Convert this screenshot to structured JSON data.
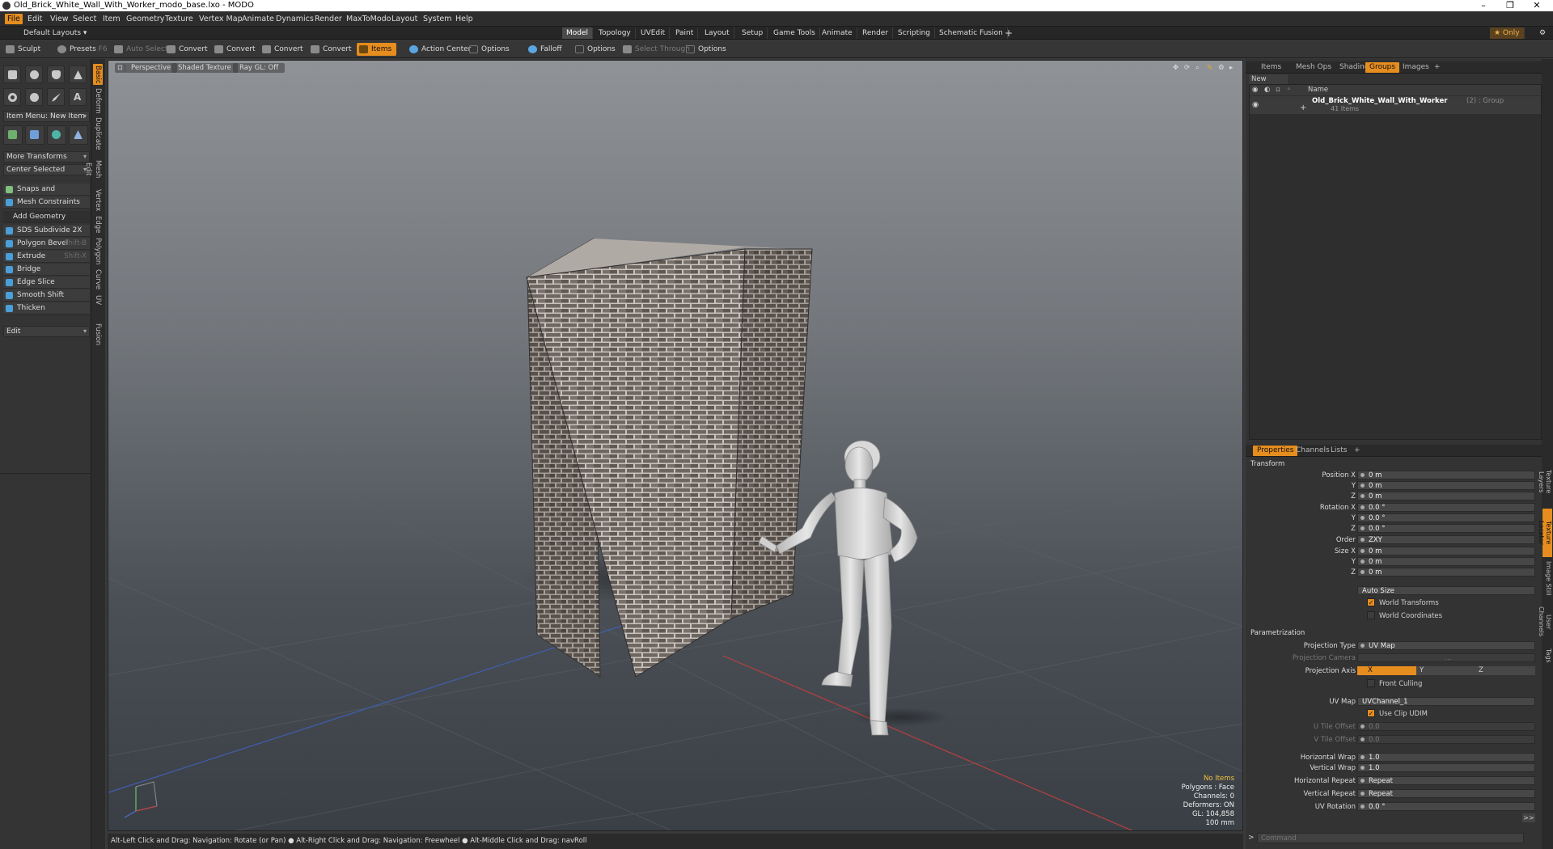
{
  "window": {
    "title": "Old_Brick_White_Wall_With_Worker_modo_base.lxo - MODO",
    "min": "–",
    "max": "❐",
    "close": "✕"
  },
  "menu": [
    "File",
    "Edit",
    "View",
    "Select",
    "Item",
    "Geometry",
    "Texture",
    "Vertex Map",
    "Animate",
    "Dynamics",
    "Render",
    "MaxToModo",
    "Layout",
    "System",
    "Help"
  ],
  "layouts": {
    "selector": "Default Layouts ▾",
    "tabs": [
      "Model",
      "Topology",
      "UVEdit",
      "Paint",
      "Layout",
      "Setup",
      "Game Tools",
      "Animate",
      "Render",
      "Scripting",
      "Schematic Fusion"
    ],
    "add": "+",
    "only": "★ Only"
  },
  "toolbar": {
    "sculpt": "Sculpt",
    "presets": "Presets",
    "presets_key": "F6",
    "auto_select": "Auto Select",
    "convert": "Convert",
    "items": "Items",
    "action_center": "Action Center",
    "options": "Options",
    "falloff": "Falloff",
    "select_through": "Select Through"
  },
  "left": {
    "item_menu": "Item Menu: New Item",
    "more_transforms": "More Transforms",
    "center_selected": "Center Selected",
    "snaps": "Snaps and Precision",
    "mesh_constraints": "Mesh Constraints",
    "add_geometry": "Add Geometry",
    "tools": [
      {
        "label": "SDS Subdivide 2X",
        "key": ""
      },
      {
        "label": "Polygon Bevel",
        "key": "Shift-B"
      },
      {
        "label": "Extrude",
        "key": "Shift-X"
      },
      {
        "label": "Bridge",
        "key": ""
      },
      {
        "label": "Edge Slice",
        "key": ""
      },
      {
        "label": "Smooth Shift",
        "key": ""
      },
      {
        "label": "Thicken",
        "key": ""
      }
    ],
    "edit": "Edit",
    "vtabs": [
      "Basic",
      "Deform",
      "Duplicate",
      "Mesh Edit",
      "Vertex",
      "Edge",
      "Polygon",
      "Curve",
      "UV",
      "Fusion"
    ]
  },
  "viewport": {
    "perspective": "Perspective",
    "shading": "Shaded Texture",
    "raygl": "Ray GL: Off",
    "hud": [
      "No Items",
      "Polygons : Face",
      "Channels: 0",
      "Deformers: ON",
      "GL: 104,858",
      "100 mm"
    ]
  },
  "status": "Alt-Left Click and Drag: Navigation: Rotate (or Pan) ● Alt-Right Click and Drag: Navigation: Freewheel ● Alt-Middle Click and Drag: navRoll",
  "scene": {
    "tabs": [
      "Items",
      "Mesh Ops",
      "Shading",
      "Groups",
      "Images",
      "+"
    ],
    "new_group": "New Group",
    "col_name": "Name",
    "group_name": "Old_Brick_White_Wall_With_Worker",
    "group_suffix": "(2) : Group",
    "group_count": "41 Items"
  },
  "props": {
    "tabs": [
      "Properties",
      "Channels",
      "Lists",
      "+"
    ],
    "transform": "Transform",
    "position": {
      "label": "Position X",
      "x": "0 m",
      "y": "0 m",
      "z": "0 m"
    },
    "rotation": {
      "label": "Rotation X",
      "x": "0.0 °",
      "y": "0.0 °",
      "z": "0.0 °"
    },
    "order": {
      "label": "Order",
      "value": "ZXY"
    },
    "size": {
      "label": "Size X",
      "x": "0 m",
      "y": "0 m",
      "z": "0 m"
    },
    "y": "Y",
    "z": "Z",
    "auto_size": "Auto Size",
    "world_transforms": "World Transforms",
    "world_coords": "World Coordinates",
    "param": "Parametrization",
    "proj_type": {
      "label": "Projection Type",
      "value": "UV Map"
    },
    "proj_camera": {
      "label": "Projection Camera",
      "value": "..."
    },
    "proj_axis": {
      "label": "Projection Axis",
      "x": "X",
      "y": "Y",
      "z": "Z"
    },
    "front_culling": "Front Culling",
    "uv_map": {
      "label": "UV Map",
      "value": "UVChannel_1"
    },
    "use_clip": "Use Clip UDIM",
    "u_tile": {
      "label": "U Tile Offset",
      "value": "0.0"
    },
    "v_tile": {
      "label": "V Tile Offset",
      "value": "0.0"
    },
    "h_wrap": {
      "label": "Horizontal Wrap",
      "value": "1.0"
    },
    "v_wrap": {
      "label": "Vertical Wrap",
      "value": "1.0"
    },
    "h_repeat": {
      "label": "Horizontal Repeat",
      "value": "Repeat"
    },
    "v_repeat": {
      "label": "Vertical Repeat",
      "value": "Repeat"
    },
    "uv_rot": {
      "label": "UV Rotation",
      "value": "0.0 °"
    },
    "command_placeholder": "Command",
    "more": ">>",
    "rvtabs": [
      "Texture Layers",
      "Texture Locator",
      "Image Still",
      "User Channels",
      "Tags"
    ]
  },
  "colors": {
    "accent": "#e58d1f",
    "brick": "#6e6661",
    "mortar": "#c9c3bd"
  }
}
